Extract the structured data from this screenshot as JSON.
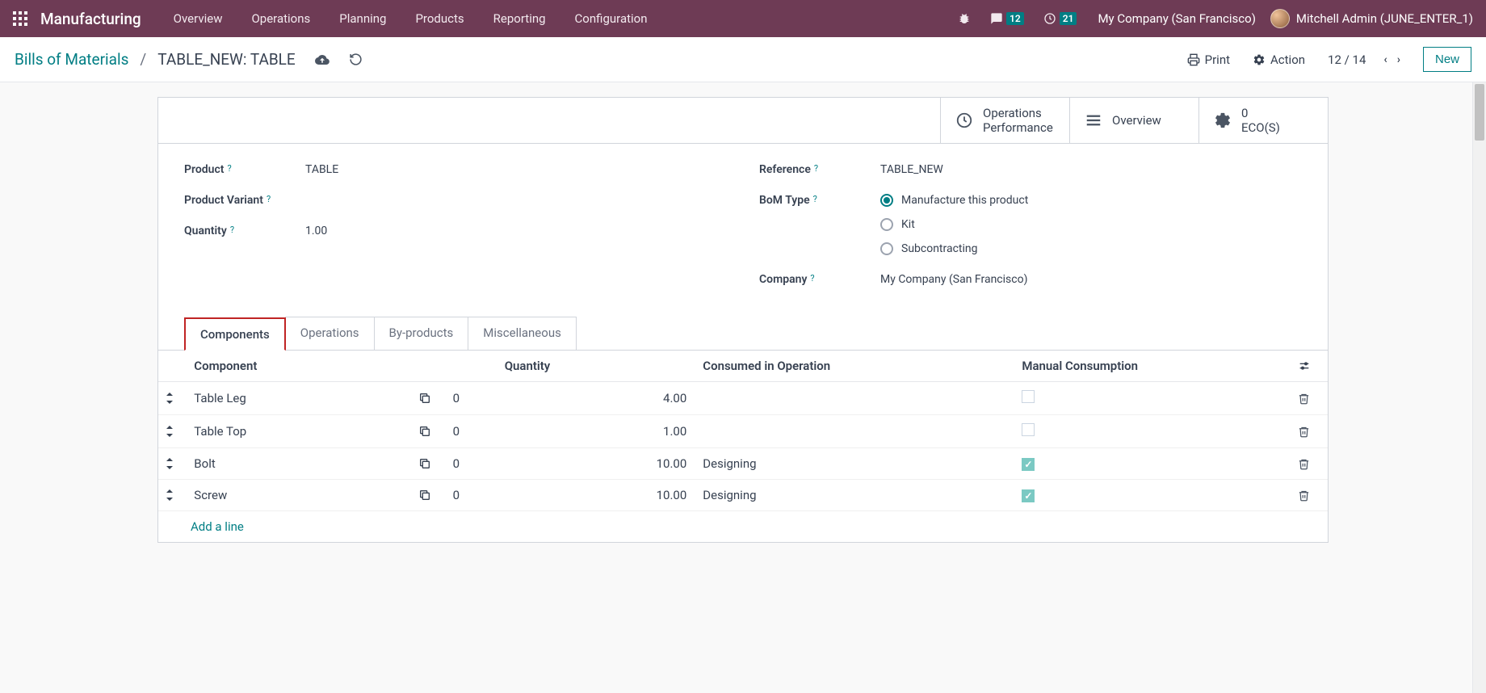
{
  "navbar": {
    "brand": "Manufacturing",
    "items": [
      "Overview",
      "Operations",
      "Planning",
      "Products",
      "Reporting",
      "Configuration"
    ],
    "chat_badge": "12",
    "clock_badge": "21",
    "company": "My Company (San Francisco)",
    "user": "Mitchell Admin (JUNE_ENTER_1)"
  },
  "breadcrumb": {
    "root": "Bills of Materials",
    "leaf": "TABLE_NEW: TABLE"
  },
  "actions": {
    "print": "Print",
    "action": "Action",
    "pager": "12 / 14",
    "new": "New"
  },
  "smart": {
    "ops_perf_line1": "Operations",
    "ops_perf_line2": "Performance",
    "overview": "Overview",
    "eco_count": "0",
    "eco_label": "ECO(S)"
  },
  "form": {
    "product_label": "Product",
    "product_value": "TABLE",
    "variant_label": "Product Variant",
    "variant_value": "",
    "quantity_label": "Quantity",
    "quantity_value": "1.00",
    "reference_label": "Reference",
    "reference_value": "TABLE_NEW",
    "bom_type_label": "BoM Type",
    "bom_opts": {
      "manufacture": "Manufacture this product",
      "kit": "Kit",
      "sub": "Subcontracting"
    },
    "company_label": "Company",
    "company_value": "My Company (San Francisco)"
  },
  "tabs": [
    "Components",
    "Operations",
    "By-products",
    "Miscellaneous"
  ],
  "table": {
    "headers": {
      "component": "Component",
      "quantity": "Quantity",
      "consumed": "Consumed in Operation",
      "manual": "Manual Consumption"
    },
    "rows": [
      {
        "name": "Table Leg",
        "extra": "0",
        "qty": "4.00",
        "consumed": "",
        "manual": false
      },
      {
        "name": "Table Top",
        "extra": "0",
        "qty": "1.00",
        "consumed": "",
        "manual": false
      },
      {
        "name": "Bolt",
        "extra": "0",
        "qty": "10.00",
        "consumed": "Designing",
        "manual": true
      },
      {
        "name": "Screw",
        "extra": "0",
        "qty": "10.00",
        "consumed": "Designing",
        "manual": true
      }
    ],
    "add_line": "Add a line"
  }
}
